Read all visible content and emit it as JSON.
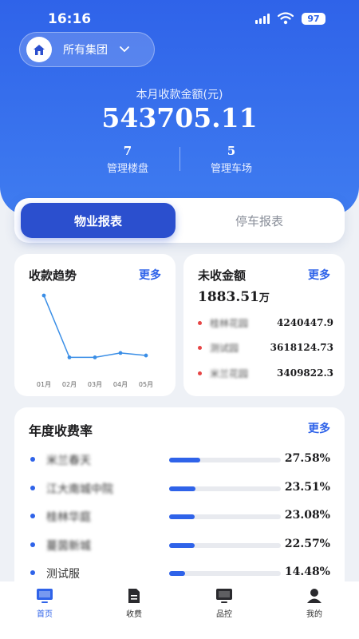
{
  "status_bar": {
    "time": "16:16",
    "battery": "97"
  },
  "header": {
    "group_selector": "所有集团"
  },
  "summary": {
    "amount_label": "本月收款金额(元)",
    "amount_value": "543705.11",
    "stats": [
      {
        "value": "7",
        "label": "管理楼盘"
      },
      {
        "value": "5",
        "label": "管理车场"
      }
    ]
  },
  "tabs": [
    {
      "label": "物业报表",
      "active": true
    },
    {
      "label": "停车报表",
      "active": false
    }
  ],
  "trend_card": {
    "title": "收款趋势",
    "more": "更多",
    "chart_data": {
      "type": "line",
      "categories": [
        "01月",
        "02月",
        "03月",
        "04月",
        "05月"
      ],
      "values": [
        100,
        2,
        2,
        9,
        5
      ],
      "ylim": [
        0,
        100
      ],
      "grid": false,
      "color": "#3a8ee6"
    }
  },
  "unpaid_card": {
    "title": "未收金额",
    "more": "更多",
    "total": "1883.51",
    "unit": "万",
    "rows": [
      {
        "name": "桂林花园",
        "value": "4240447.9"
      },
      {
        "name": "测试园",
        "value": "3618124.73"
      },
      {
        "name": "米兰花园",
        "value": "3409822.3"
      }
    ]
  },
  "rate_card": {
    "title": "年度收费率",
    "more": "更多",
    "rows": [
      {
        "name": "米兰春天",
        "percent": "27.58%",
        "fill": 0.2758,
        "blurred": true
      },
      {
        "name": "江大南城中院",
        "percent": "23.51%",
        "fill": 0.2351,
        "blurred": true
      },
      {
        "name": "桂林华庭",
        "percent": "23.08%",
        "fill": 0.2308,
        "blurred": true
      },
      {
        "name": "蔓茵新城",
        "percent": "22.57%",
        "fill": 0.2257,
        "blurred": true
      },
      {
        "name": "测试服",
        "percent": "14.48%",
        "fill": 0.1448,
        "blurred": false
      }
    ]
  },
  "bottom_nav": [
    {
      "label": "首页",
      "icon": "monitor-icon",
      "active": true
    },
    {
      "label": "收费",
      "icon": "document-icon",
      "active": false
    },
    {
      "label": "品控",
      "icon": "monitor-icon",
      "active": false
    },
    {
      "label": "我的",
      "icon": "user-icon",
      "active": false
    }
  ],
  "colors": {
    "primary": "#2f63e9",
    "tab_active": "#2b4fce",
    "dot_red": "#e64545"
  }
}
